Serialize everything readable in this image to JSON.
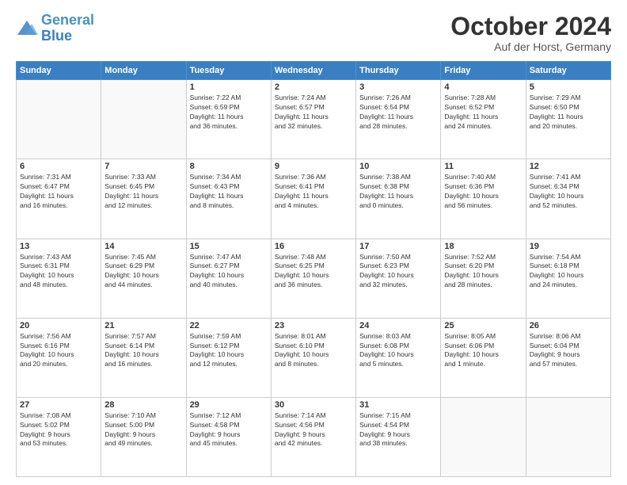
{
  "logo": {
    "line1": "General",
    "line2": "Blue"
  },
  "title": "October 2024",
  "subtitle": "Auf der Horst, Germany",
  "days_of_week": [
    "Sunday",
    "Monday",
    "Tuesday",
    "Wednesday",
    "Thursday",
    "Friday",
    "Saturday"
  ],
  "weeks": [
    [
      {
        "day": "",
        "info": ""
      },
      {
        "day": "",
        "info": ""
      },
      {
        "day": "1",
        "info": "Sunrise: 7:22 AM\nSunset: 6:59 PM\nDaylight: 11 hours\nand 36 minutes."
      },
      {
        "day": "2",
        "info": "Sunrise: 7:24 AM\nSunset: 6:57 PM\nDaylight: 11 hours\nand 32 minutes."
      },
      {
        "day": "3",
        "info": "Sunrise: 7:26 AM\nSunset: 6:54 PM\nDaylight: 11 hours\nand 28 minutes."
      },
      {
        "day": "4",
        "info": "Sunrise: 7:28 AM\nSunset: 6:52 PM\nDaylight: 11 hours\nand 24 minutes."
      },
      {
        "day": "5",
        "info": "Sunrise: 7:29 AM\nSunset: 6:50 PM\nDaylight: 11 hours\nand 20 minutes."
      }
    ],
    [
      {
        "day": "6",
        "info": "Sunrise: 7:31 AM\nSunset: 6:47 PM\nDaylight: 11 hours\nand 16 minutes."
      },
      {
        "day": "7",
        "info": "Sunrise: 7:33 AM\nSunset: 6:45 PM\nDaylight: 11 hours\nand 12 minutes."
      },
      {
        "day": "8",
        "info": "Sunrise: 7:34 AM\nSunset: 6:43 PM\nDaylight: 11 hours\nand 8 minutes."
      },
      {
        "day": "9",
        "info": "Sunrise: 7:36 AM\nSunset: 6:41 PM\nDaylight: 11 hours\nand 4 minutes."
      },
      {
        "day": "10",
        "info": "Sunrise: 7:38 AM\nSunset: 6:38 PM\nDaylight: 11 hours\nand 0 minutes."
      },
      {
        "day": "11",
        "info": "Sunrise: 7:40 AM\nSunset: 6:36 PM\nDaylight: 10 hours\nand 56 minutes."
      },
      {
        "day": "12",
        "info": "Sunrise: 7:41 AM\nSunset: 6:34 PM\nDaylight: 10 hours\nand 52 minutes."
      }
    ],
    [
      {
        "day": "13",
        "info": "Sunrise: 7:43 AM\nSunset: 6:31 PM\nDaylight: 10 hours\nand 48 minutes."
      },
      {
        "day": "14",
        "info": "Sunrise: 7:45 AM\nSunset: 6:29 PM\nDaylight: 10 hours\nand 44 minutes."
      },
      {
        "day": "15",
        "info": "Sunrise: 7:47 AM\nSunset: 6:27 PM\nDaylight: 10 hours\nand 40 minutes."
      },
      {
        "day": "16",
        "info": "Sunrise: 7:48 AM\nSunset: 6:25 PM\nDaylight: 10 hours\nand 36 minutes."
      },
      {
        "day": "17",
        "info": "Sunrise: 7:50 AM\nSunset: 6:23 PM\nDaylight: 10 hours\nand 32 minutes."
      },
      {
        "day": "18",
        "info": "Sunrise: 7:52 AM\nSunset: 6:20 PM\nDaylight: 10 hours\nand 28 minutes."
      },
      {
        "day": "19",
        "info": "Sunrise: 7:54 AM\nSunset: 6:18 PM\nDaylight: 10 hours\nand 24 minutes."
      }
    ],
    [
      {
        "day": "20",
        "info": "Sunrise: 7:56 AM\nSunset: 6:16 PM\nDaylight: 10 hours\nand 20 minutes."
      },
      {
        "day": "21",
        "info": "Sunrise: 7:57 AM\nSunset: 6:14 PM\nDaylight: 10 hours\nand 16 minutes."
      },
      {
        "day": "22",
        "info": "Sunrise: 7:59 AM\nSunset: 6:12 PM\nDaylight: 10 hours\nand 12 minutes."
      },
      {
        "day": "23",
        "info": "Sunrise: 8:01 AM\nSunset: 6:10 PM\nDaylight: 10 hours\nand 8 minutes."
      },
      {
        "day": "24",
        "info": "Sunrise: 8:03 AM\nSunset: 6:08 PM\nDaylight: 10 hours\nand 5 minutes."
      },
      {
        "day": "25",
        "info": "Sunrise: 8:05 AM\nSunset: 6:06 PM\nDaylight: 10 hours\nand 1 minute."
      },
      {
        "day": "26",
        "info": "Sunrise: 8:06 AM\nSunset: 6:04 PM\nDaylight: 9 hours\nand 57 minutes."
      }
    ],
    [
      {
        "day": "27",
        "info": "Sunrise: 7:08 AM\nSunset: 5:02 PM\nDaylight: 9 hours\nand 53 minutes."
      },
      {
        "day": "28",
        "info": "Sunrise: 7:10 AM\nSunset: 5:00 PM\nDaylight: 9 hours\nand 49 minutes."
      },
      {
        "day": "29",
        "info": "Sunrise: 7:12 AM\nSunset: 4:58 PM\nDaylight: 9 hours\nand 45 minutes."
      },
      {
        "day": "30",
        "info": "Sunrise: 7:14 AM\nSunset: 4:56 PM\nDaylight: 9 hours\nand 42 minutes."
      },
      {
        "day": "31",
        "info": "Sunrise: 7:15 AM\nSunset: 4:54 PM\nDaylight: 9 hours\nand 38 minutes."
      },
      {
        "day": "",
        "info": ""
      },
      {
        "day": "",
        "info": ""
      }
    ]
  ]
}
